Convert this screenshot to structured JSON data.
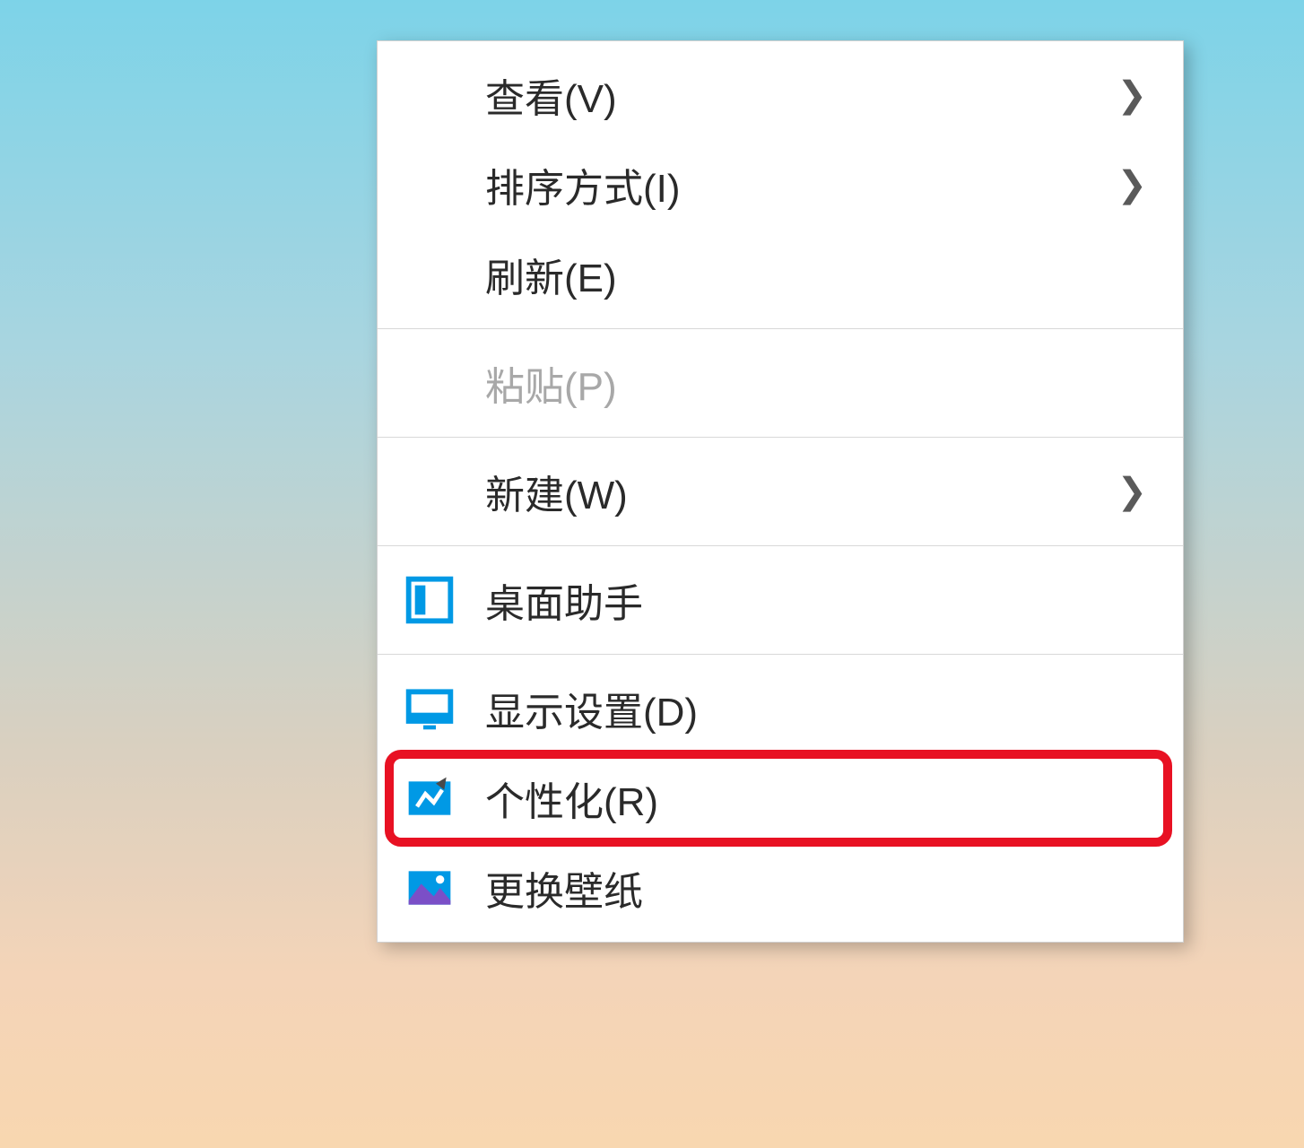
{
  "menu": {
    "items": [
      {
        "label": "查看(V)",
        "has_submenu": true,
        "disabled": false,
        "icon": null
      },
      {
        "label": "排序方式(I)",
        "has_submenu": true,
        "disabled": false,
        "icon": null
      },
      {
        "label": "刷新(E)",
        "has_submenu": false,
        "disabled": false,
        "icon": null
      },
      {
        "separator": true
      },
      {
        "label": "粘贴(P)",
        "has_submenu": false,
        "disabled": true,
        "icon": null
      },
      {
        "separator": true
      },
      {
        "label": "新建(W)",
        "has_submenu": true,
        "disabled": false,
        "icon": null
      },
      {
        "separator": true
      },
      {
        "label": "桌面助手",
        "has_submenu": false,
        "disabled": false,
        "icon": "panel"
      },
      {
        "separator": true
      },
      {
        "label": "显示设置(D)",
        "has_submenu": false,
        "disabled": false,
        "icon": "display"
      },
      {
        "label": "个性化(R)",
        "has_submenu": false,
        "disabled": false,
        "icon": "personalize",
        "highlighted": true
      },
      {
        "label": "更换壁纸",
        "has_submenu": false,
        "disabled": false,
        "icon": "wallpaper"
      }
    ]
  },
  "colors": {
    "highlight_border": "#e81123",
    "icon_blue": "#0099e5"
  }
}
